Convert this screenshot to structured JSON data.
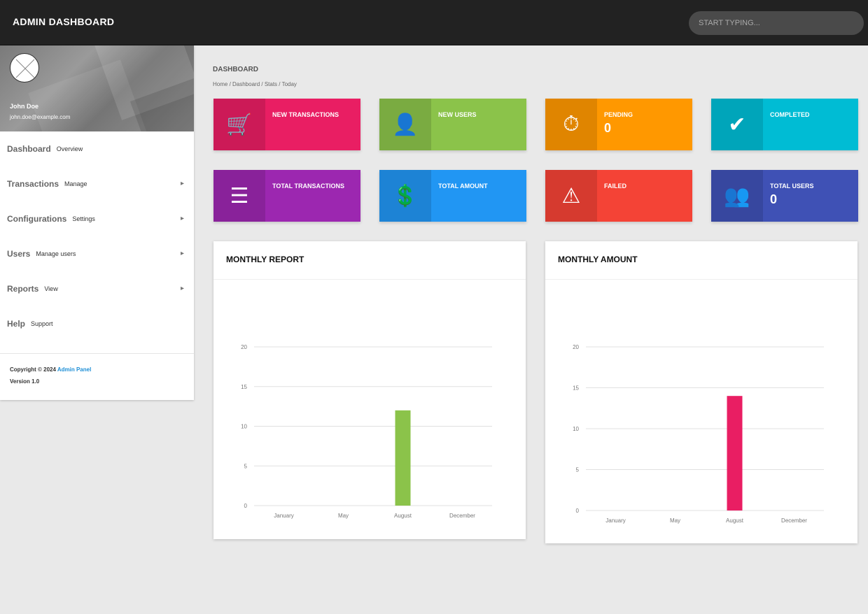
{
  "topbar": {
    "brand": "ADMIN DASHBOARD",
    "search_placeholder": "START TYPING..."
  },
  "user": {
    "name": "John Doe",
    "email": "john.doe@example.com"
  },
  "menu": [
    {
      "label": "Dashboard",
      "sub": "Overview",
      "active": true,
      "caret": ""
    },
    {
      "label": "Transactions",
      "sub": "Manage",
      "active": false,
      "caret": "▸"
    },
    {
      "label": "Configurations",
      "sub": "Settings",
      "active": false,
      "caret": "▸"
    },
    {
      "label": "Users",
      "sub": "Manage users",
      "active": false,
      "caret": "▸"
    },
    {
      "label": "Reports",
      "sub": "View",
      "active": false,
      "caret": "▸"
    },
    {
      "label": "Help",
      "sub": "Support",
      "active": false,
      "caret": ""
    }
  ],
  "footer": {
    "copyright_prefix": "Copyright © 2024",
    "copyright_link": "Admin Panel",
    "version": "Version 1.0"
  },
  "page": {
    "title": "DASHBOARD",
    "breadcrumb": "Home / Dashboard / Stats / Today"
  },
  "info_boxes": [
    {
      "text": "NEW TRANSACTIONS",
      "number": "",
      "color": "#e91e63",
      "icon": "cart-icon"
    },
    {
      "text": "NEW USERS",
      "number": "",
      "color": "#8bc34a",
      "icon": "person-icon"
    },
    {
      "text": "PENDING",
      "number": "0",
      "color": "#ff9800",
      "icon": "clock-icon"
    },
    {
      "text": "COMPLETED",
      "number": "",
      "color": "#00bcd4",
      "icon": "check-icon"
    },
    {
      "text": "TOTAL TRANSACTIONS",
      "number": "",
      "color": "#9c27b0",
      "icon": "list-icon"
    },
    {
      "text": "TOTAL AMOUNT",
      "number": "",
      "color": "#2196f3",
      "icon": "money-icon"
    },
    {
      "text": "FAILED",
      "number": "",
      "color": "#f44336",
      "icon": "warning-icon"
    },
    {
      "text": "TOTAL USERS",
      "number": "0",
      "color": "#3f51b5",
      "icon": "people-icon"
    }
  ],
  "chart_data": [
    {
      "type": "bar",
      "title": "MONTHLY REPORT",
      "categories": [
        "January",
        "May",
        "August",
        "December"
      ],
      "values": [
        0,
        0,
        12,
        0
      ],
      "yticks": [
        0,
        5,
        10,
        15,
        20
      ],
      "ylim": [
        0,
        20
      ],
      "color": "#8bc34a",
      "grid": true
    },
    {
      "type": "bar",
      "title": "MONTHLY AMOUNT",
      "categories": [
        "January",
        "May",
        "August",
        "December"
      ],
      "values": [
        0,
        0,
        14,
        0
      ],
      "yticks": [
        0,
        5,
        10,
        15,
        20
      ],
      "ylim": [
        0,
        20
      ],
      "color": "#e91e63",
      "grid": true
    }
  ]
}
